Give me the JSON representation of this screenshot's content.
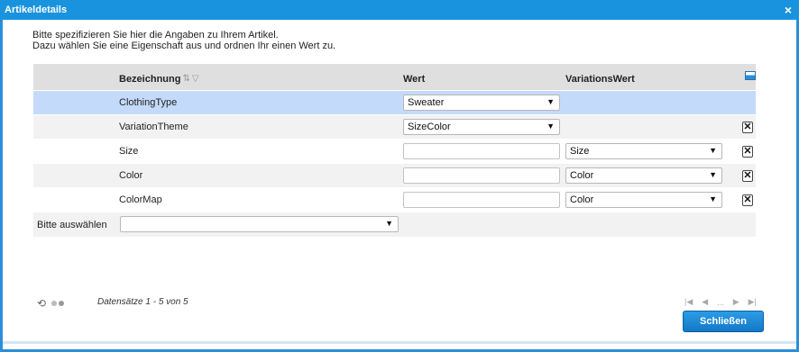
{
  "window": {
    "title": "Artikeldetails",
    "close_glyph": "×"
  },
  "intro": {
    "line1": "Bitte spezifizieren Sie hier die Angaben zu Ihrem Artikel.",
    "line2": "Dazu wählen Sie eine Eigenschaft aus und ordnen Ihr einen Wert zu."
  },
  "grid": {
    "headers": {
      "name": "Bezeichnung",
      "value": "Wert",
      "variation": "VariationsWert"
    },
    "rows": [
      {
        "name": "ClothingType",
        "value": "Sweater"
      },
      {
        "name": "VariationTheme",
        "value": "SizeColor",
        "delete": "✕"
      },
      {
        "name": "Size",
        "value": "",
        "variation": "Size",
        "delete": "✕"
      },
      {
        "name": "Color",
        "value": "",
        "variation": "Color",
        "delete": "✕"
      },
      {
        "name": "ColorMap",
        "value": "",
        "variation": "Color",
        "delete": "✕"
      }
    ],
    "picker": {
      "label": "Bitte auswählen",
      "value": ""
    }
  },
  "footer": {
    "records": "Datensätze 1 - 5 von 5",
    "pager": {
      "first": "|◀",
      "prev": "◀",
      "ellipsis": "...",
      "next": "▶",
      "last": "▶|"
    },
    "close_button": "Schließen"
  },
  "icons": {
    "dropdown": "▼",
    "sort": "⇅",
    "filter": "▽",
    "refresh": "⟲"
  },
  "colors": {
    "accent": "#1a93de",
    "selected_row": "#c4dafa"
  }
}
